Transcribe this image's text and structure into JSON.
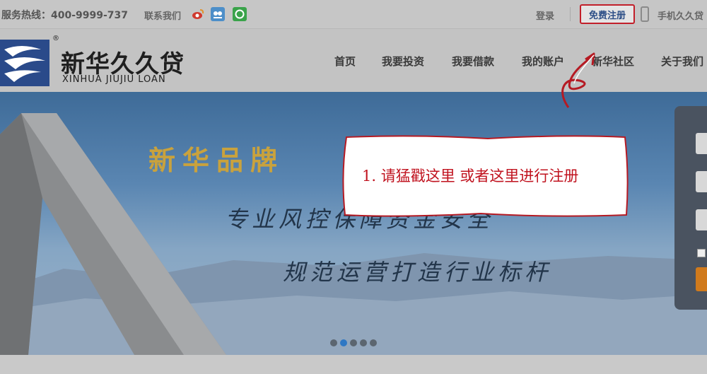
{
  "topbar": {
    "hotline": "服务热线：400-9999-737",
    "contact_label": "联系我们",
    "social_icons": [
      "weibo-icon",
      "tencent-weibo-icon",
      "wechat-icon"
    ],
    "login_label": "登录",
    "register_label": "免费注册",
    "mobile_label": "手机久久贷"
  },
  "brand": {
    "registered_mark": "®",
    "name_cn": "新华久久贷",
    "name_en": "XINHUA JIUJIU LOAN"
  },
  "nav": {
    "items": [
      {
        "label": "首页"
      },
      {
        "label": "我要投资"
      },
      {
        "label": "我要借款"
      },
      {
        "label": "我的账户"
      },
      {
        "label": "新华社区"
      },
      {
        "label": "关于我们"
      }
    ]
  },
  "banner": {
    "slogan_brand": "新华品牌",
    "slogan_line2": "专业风控保障资金安全",
    "slogan_line3": "规范运营打造行业标杆",
    "carousel_count": 5,
    "carousel_active_index": 1
  },
  "annotation": {
    "text": "1. 请猛戳这里  或者这里进行注册",
    "color": "#c0121e"
  },
  "colors": {
    "register_border": "#c21f2a",
    "register_text": "#2d4f87",
    "login_button": "#d07a1c"
  }
}
